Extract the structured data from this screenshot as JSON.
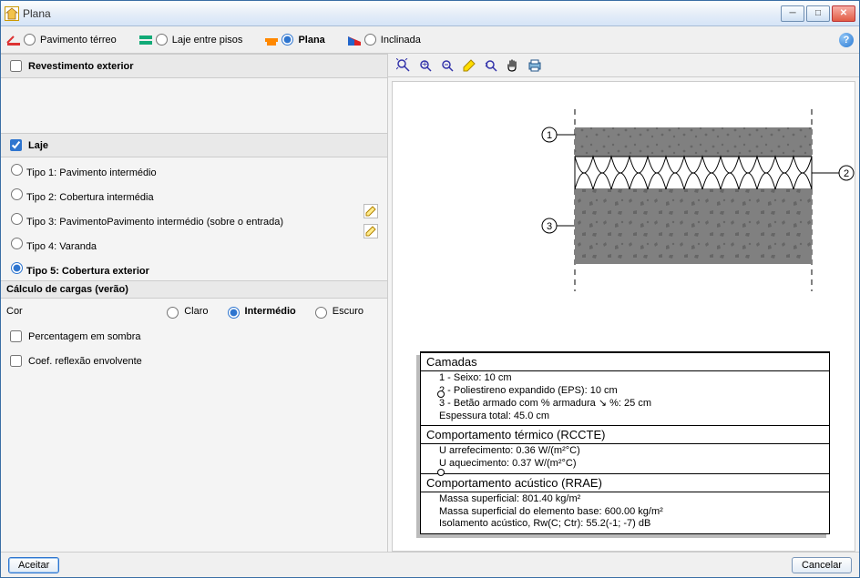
{
  "window": {
    "title": "Plana"
  },
  "toolbar": {
    "items": [
      {
        "label": "Pavimento térreo",
        "selected": false
      },
      {
        "label": "Laje entre pisos",
        "selected": false
      },
      {
        "label": "Plana",
        "selected": true
      },
      {
        "label": "Inclinada",
        "selected": false
      }
    ]
  },
  "left": {
    "revestimento_header": "Revestimento exterior",
    "laje_header": "Laje",
    "laje_options": [
      {
        "label": "Tipo 1: Pavimento intermédio",
        "selected": false
      },
      {
        "label": "Tipo 2: Cobertura intermédia",
        "selected": false
      },
      {
        "label": "Tipo 3: PavimentoPavimento intermédio (sobre o entrada)",
        "selected": false
      },
      {
        "label": "Tipo 4: Varanda",
        "selected": false
      },
      {
        "label": "Tipo 5: Cobertura exterior",
        "selected": true
      }
    ],
    "calc_header": "Cálculo de cargas (verão)",
    "cor_label": "Cor",
    "cor_options": [
      {
        "label": "Claro",
        "selected": false
      },
      {
        "label": "Intermédio",
        "selected": true
      },
      {
        "label": "Escuro",
        "selected": false
      }
    ],
    "perc_sombra": "Percentagem em sombra",
    "coef_reflexao": "Coef. reflexão envolvente"
  },
  "diagram": {
    "callouts": {
      "c1": "1",
      "c2": "2",
      "c3": "3"
    }
  },
  "panel": {
    "camadas_title": "Camadas",
    "camadas_body": "1 - Seixo: 10 cm\n2 - Poliestireno expandido (EPS): 10 cm\n3 - Betão armado com % armadura ↘ %: 25 cm\nEspessura total: 45.0 cm",
    "termico_title": "Comportamento térmico (RCCTE)",
    "termico_body": "U arrefecimento: 0.36 W/(m²°C)\nU aquecimento: 0.37 W/(m²°C)",
    "acustico_title": "Comportamento acústico (RRAE)",
    "acustico_body": "Massa superficial: 801.40 kg/m²\nMassa superficial do elemento base: 600.00 kg/m²\nIsolamento acústico, Rw(C; Ctr): 55.2(-1; -7) dB"
  },
  "footer": {
    "accept": "Aceitar",
    "cancel": "Cancelar"
  }
}
